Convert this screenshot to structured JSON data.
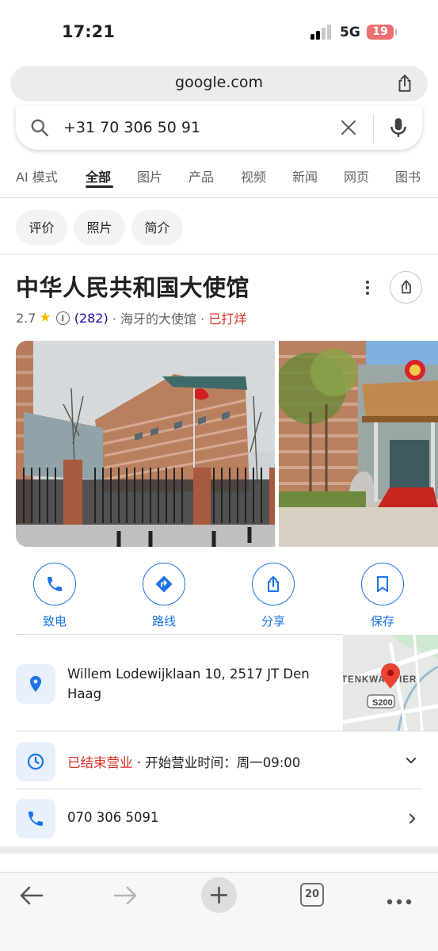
{
  "status_bar": {
    "time": "17:21",
    "network": "5G",
    "battery": "19"
  },
  "browser": {
    "url": "google.com"
  },
  "search": {
    "query": "+31 70 306 50 91"
  },
  "tabs": [
    {
      "label": "AI 模式",
      "active": false
    },
    {
      "label": "全部",
      "active": true
    },
    {
      "label": "图片",
      "active": false
    },
    {
      "label": "产品",
      "active": false
    },
    {
      "label": "视频",
      "active": false
    },
    {
      "label": "新闻",
      "active": false
    },
    {
      "label": "网页",
      "active": false
    },
    {
      "label": "图书",
      "active": false
    }
  ],
  "chips": [
    "评价",
    "照片",
    "简介"
  ],
  "business": {
    "name": "中华人民共和国大使馆",
    "rating": "2.7",
    "reviews": "(282)",
    "category": "· 海牙的大使馆 ·",
    "status": "已打烊"
  },
  "actions": [
    {
      "label": "致电",
      "icon": "phone-icon"
    },
    {
      "label": "路线",
      "icon": "directions-icon"
    },
    {
      "label": "分享",
      "icon": "share-icon"
    },
    {
      "label": "保存",
      "icon": "bookmark-icon"
    }
  ],
  "map": {
    "label": "TENKWARTIER",
    "road": "S200"
  },
  "details": {
    "address": "Willem Lodewijklaan 10, 2517 JT Den Haag",
    "hours_status": "已结束营业",
    "hours_text": "· 开始营业时间：周一09:00",
    "phone": "070 306 5091"
  },
  "toolbar": {
    "tabs_count": "20"
  },
  "colors": {
    "accent": "#1a73e8",
    "closed": "#d93025",
    "star": "#fbbc04"
  }
}
